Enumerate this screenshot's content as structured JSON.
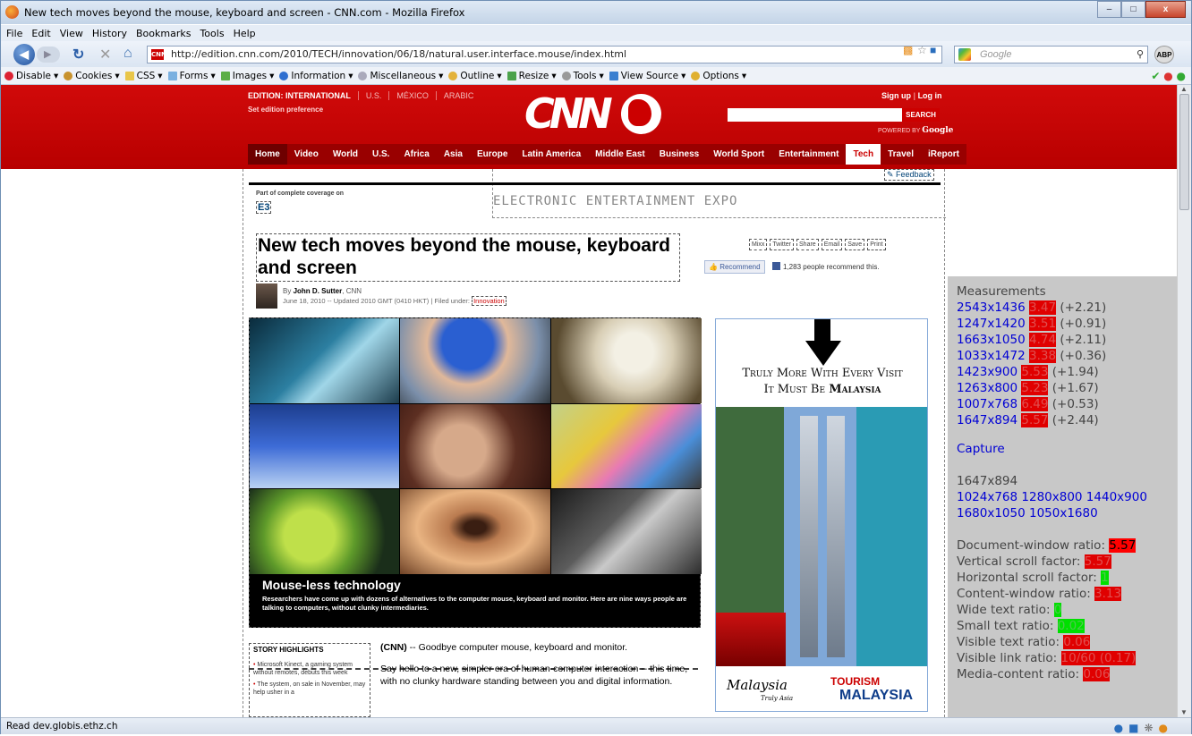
{
  "window": {
    "title": "New tech moves beyond the mouse, keyboard and screen - CNN.com - Mozilla Firefox",
    "min": "–",
    "max": "□",
    "close": "x"
  },
  "menu": [
    "File",
    "Edit",
    "View",
    "History",
    "Bookmarks",
    "Tools",
    "Help"
  ],
  "url": "http://edition.cnn.com/2010/TECH/innovation/06/18/natural.user.interface.mouse/index.html",
  "search": {
    "placeholder": "Google"
  },
  "addon": "ABP",
  "webdev": [
    "Disable",
    "Cookies",
    "CSS",
    "Forms",
    "Images",
    "Information",
    "Miscellaneous",
    "Outline",
    "Resize",
    "Tools",
    "View Source",
    "Options"
  ],
  "cnn": {
    "edition": "EDITION: INTERNATIONAL",
    "editions": [
      "U.S.",
      "MÉXICO",
      "ARABIC"
    ],
    "set_pref": "Set edition preference",
    "signup": "Sign up",
    "login": "Log in",
    "search_btn": "SEARCH",
    "powered": "POWERED BY",
    "google": "Google",
    "nav": [
      "Home",
      "Video",
      "World",
      "U.S.",
      "Africa",
      "Asia",
      "Europe",
      "Latin America",
      "Middle East",
      "Business",
      "World Sport",
      "Entertainment",
      "Tech",
      "Travel",
      "iReport"
    ],
    "feedback": "Feedback",
    "part_of": "Part of complete coverage on",
    "e3": "E3",
    "e3_banner": "ELECTRONIC ENTERTAINMENT EXPO",
    "headline": "New tech moves beyond the mouse, keyboard and screen",
    "shares": [
      "Mixx",
      "Twitter",
      "Share",
      "Email",
      "Save",
      "Print"
    ],
    "recommend": "Recommend",
    "recommend_count": "1,283 people recommend this.",
    "by": "By",
    "author": "John D. Sutter",
    "source": ", CNN",
    "updated": "June 18, 2010 -- Updated 2010 GMT (0410 HKT) | Filed under: ",
    "filed": "Innovation",
    "gallery_title": "Mouse-less technology",
    "gallery_text": "Researchers have come up with dozens of alternatives to the computer mouse, keyboard and monitor. Here are nine ways people are talking to computers, without clunky intermediaries.",
    "highlights_title": "STORY HIGHLIGHTS",
    "highlights": [
      "Microsoft Kinect, a gaming system without remotes, debuts this week",
      "The system, on sale in November, may help usher in a"
    ],
    "lead_cnn": "(CNN)",
    "lead": " -- Goodbye computer mouse, keyboard and monitor.",
    "para2": "Say hello to a new, simpler era of human-computer interaction -- this time, with no clunky hardware standing between you and digital information.",
    "ad_line1": "Truly More With Every Visit",
    "ad_line2a": "It Must Be ",
    "ad_line2b": "Malaysia",
    "ad_logo1": "Malaysia",
    "ad_logo1_sub": "Truly Asia",
    "ad_logo2a": "TOURISM",
    "ad_logo2b": "MALAYSIA"
  },
  "panel": {
    "title": "Measurements",
    "rows": [
      {
        "res": "2543x1436",
        "val": "3.47",
        "delta": "(+2.21)"
      },
      {
        "res": "1247x1420",
        "val": "3.51",
        "delta": "(+0.91)"
      },
      {
        "res": "1663x1050",
        "val": "4.74",
        "delta": "(+2.11)"
      },
      {
        "res": "1033x1472",
        "val": "3.38",
        "delta": "(+0.36)"
      },
      {
        "res": "1423x900",
        "val": "5.53",
        "delta": "(+1.94)"
      },
      {
        "res": "1263x800",
        "val": "5.23",
        "delta": "(+1.67)"
      },
      {
        "res": "1007x768",
        "val": "6.49",
        "delta": "(+0.53)"
      },
      {
        "res": "1647x894",
        "val": "5.57",
        "delta": "(+2.44)"
      }
    ],
    "capture": "Capture",
    "current": "1647x894",
    "presets1": "1024x768 1280x800 1440x900",
    "presets2": "1680x1050 1050x1680",
    "metrics": [
      {
        "label": "Document-window ratio: ",
        "val": "5.57",
        "kind": "rb"
      },
      {
        "label": "Vertical scroll factor: ",
        "val": "5.57",
        "kind": "r"
      },
      {
        "label": "Horizontal scroll factor: ",
        "val": "1",
        "kind": "g"
      },
      {
        "label": "Content-window ratio: ",
        "val": "3.13",
        "kind": "r"
      },
      {
        "label": "Wide text ratio: ",
        "val": "0",
        "kind": "g"
      },
      {
        "label": "Small text ratio: ",
        "val": "0.02",
        "kind": "g"
      },
      {
        "label": "Visible text ratio: ",
        "val": "0.06",
        "kind": "r"
      },
      {
        "label": "Visible link ratio: ",
        "val": "10/60 (0.17)",
        "kind": "r"
      },
      {
        "label": "Media-content ratio: ",
        "val": "0.06",
        "kind": "r"
      }
    ]
  },
  "status": "Read dev.globis.ethz.ch"
}
